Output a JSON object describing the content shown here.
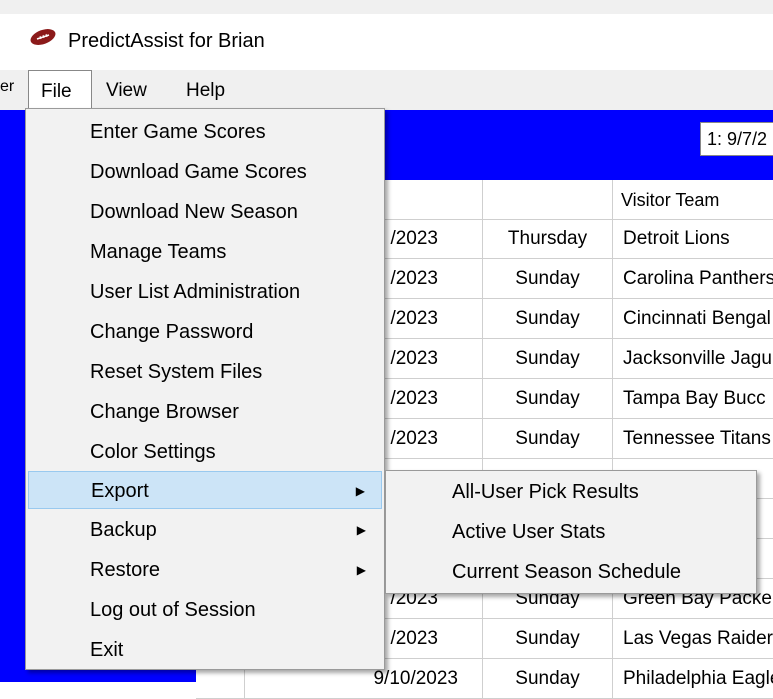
{
  "window": {
    "title": "PredictAssist for Brian"
  },
  "menubar": {
    "left_fragment": "er",
    "items": [
      {
        "label": "File"
      },
      {
        "label": "View"
      },
      {
        "label": "Help"
      }
    ]
  },
  "week_select": {
    "value": "1: 9/7/2"
  },
  "grid": {
    "headers": {
      "visitor": "Visitor Team"
    },
    "rows": [
      {
        "date": "/2023",
        "day": "Thursday",
        "visitor": "Detroit Lions"
      },
      {
        "date": "/2023",
        "day": "Sunday",
        "visitor": "Carolina Panthers"
      },
      {
        "date": "/2023",
        "day": "Sunday",
        "visitor": "Cincinnati Bengal"
      },
      {
        "date": "/2023",
        "day": "Sunday",
        "visitor": "Jacksonville Jagu"
      },
      {
        "date": "/2023",
        "day": "Sunday",
        "visitor": "Tampa Bay Bucc"
      },
      {
        "date": "/2023",
        "day": "Sunday",
        "visitor": "Tennessee Titans"
      },
      {
        "date": "",
        "day": "",
        "visitor": ""
      },
      {
        "date": "",
        "day": "",
        "visitor": "s"
      },
      {
        "date": "",
        "day": "",
        "visitor": "ls"
      },
      {
        "date": "/2023",
        "day": "Sunday",
        "visitor": "Green Bay Packe"
      },
      {
        "date": "/2023",
        "day": "Sunday",
        "visitor": "Las Vegas Raider"
      },
      {
        "date": "9/10/2023",
        "day": "Sunday",
        "visitor": "Philadelphia Eagle"
      }
    ]
  },
  "file_menu": {
    "items": [
      {
        "label": "Enter Game Scores"
      },
      {
        "label": "Download Game Scores"
      },
      {
        "label": "Download New Season"
      },
      {
        "label": "Manage Teams"
      },
      {
        "label": "User List Administration"
      },
      {
        "label": "Change Password"
      },
      {
        "label": "Reset System Files"
      },
      {
        "label": "Change Browser"
      },
      {
        "label": "Color Settings"
      },
      {
        "label": "Export",
        "submenu": true,
        "highlighted": true
      },
      {
        "label": "Backup",
        "submenu": true
      },
      {
        "label": "Restore",
        "submenu": true
      },
      {
        "label": "Log out of Session"
      },
      {
        "label": "Exit"
      }
    ]
  },
  "export_submenu": {
    "items": [
      {
        "label": "All-User Pick Results"
      },
      {
        "label": "Active User Stats"
      },
      {
        "label": "Current Season Schedule"
      }
    ]
  },
  "colors": {
    "accent_blue": "#0000ff",
    "highlight": "#cce4f7",
    "menu_bg": "#f2f2f2"
  },
  "icons": {
    "app": "football-icon",
    "submenu": "triangle-right-icon"
  }
}
